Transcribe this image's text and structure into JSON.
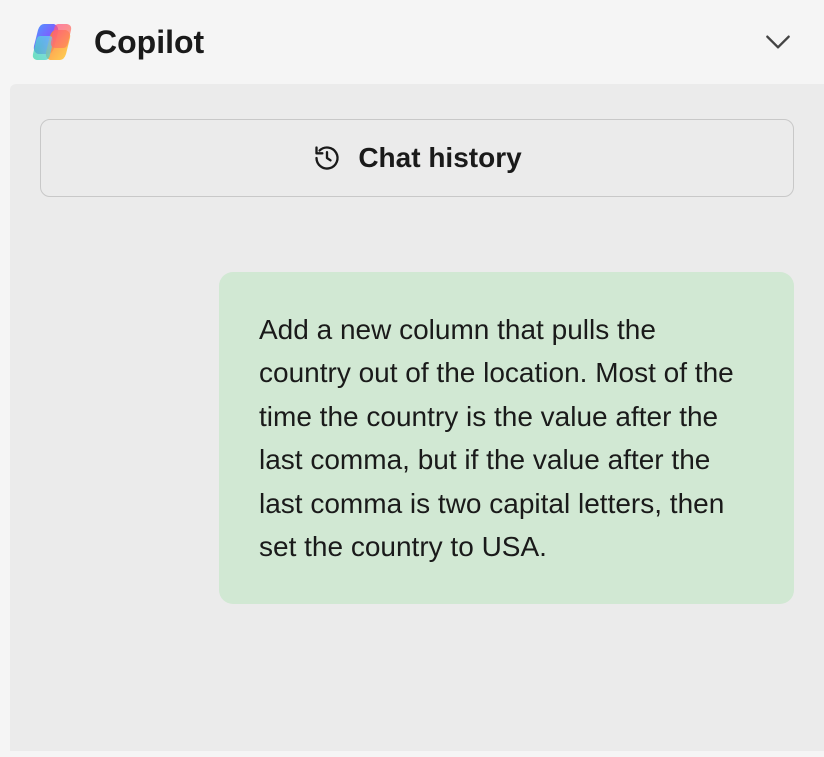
{
  "header": {
    "title": "Copilot"
  },
  "chat_history": {
    "label": "Chat history"
  },
  "messages": {
    "user_message": "Add a new column that pulls the country out of the location. Most of the time the country is the value after the last comma, but if the value after the last comma is two capital letters, then set the country to USA."
  }
}
